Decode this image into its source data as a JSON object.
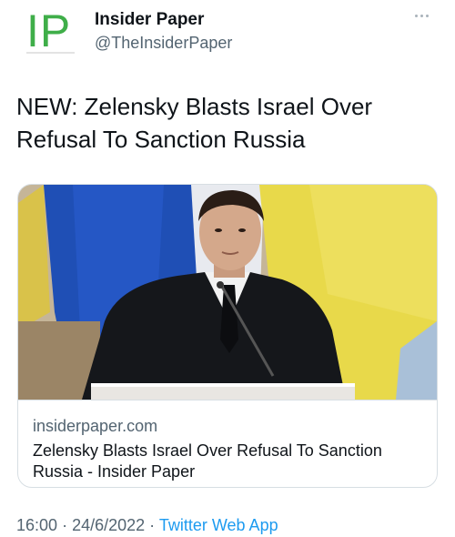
{
  "account": {
    "logo_text": "IP",
    "name": "Insider Paper",
    "handle": "@TheInsiderPaper"
  },
  "tweet": {
    "text": "NEW: Zelensky Blasts Israel Over Refusal To Sanction Russia"
  },
  "card": {
    "domain": "insiderpaper.com",
    "title": "Zelensky Blasts Israel Over Refusal To Sanction Russia - Insider Paper"
  },
  "meta": {
    "time": "16:00",
    "separator": "·",
    "date": "24/6/2022",
    "app": "Twitter Web App"
  },
  "icons": {
    "more": "more-horizontal-icon"
  },
  "colors": {
    "brand_green": "#3fae49",
    "link_blue": "#1d9bf0",
    "secondary_text": "#536471",
    "flag_blue": "#1f4fb5",
    "flag_yellow": "#e8d94a"
  }
}
